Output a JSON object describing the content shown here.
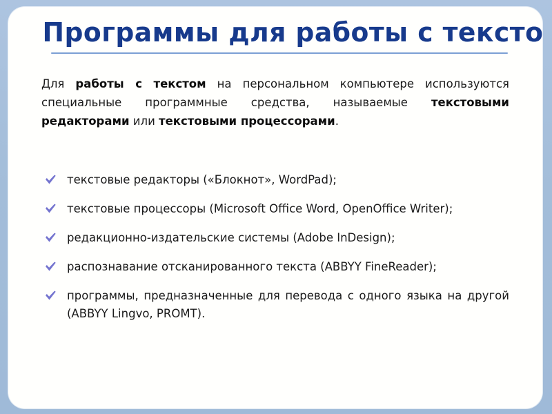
{
  "slide": {
    "title": "Программы для работы с текстом",
    "accent_title_color": "#173a8c",
    "rule_color": "#7b9fd4",
    "frame_color": "#a3bdd9",
    "card_color": "#fffffd",
    "bullet_color": "#7474cf",
    "body_color": "#1b1b1b"
  },
  "intro": {
    "part1": "Для ",
    "bold1": "работы с текстом",
    "part2": " на персональном компьютере используются специальные программные средства, называемые ",
    "bold2": "текстовыми редакторами",
    "part3": " или ",
    "bold3": "текстовыми процессорами",
    "part4": "."
  },
  "list": {
    "bullet_icon": "check-icon",
    "items": [
      {
        "text": "текстовые редакторы («Блокнот», WordPad);"
      },
      {
        "text": "текстовые процессоры (Microsoft Office Word, OpenOffice Writer);"
      },
      {
        "text": "редакционно-издательские системы (Adobe InDesign);"
      },
      {
        "text": "распознавание отсканированного текста (ABBYY FineReader);"
      },
      {
        "text": "программы, предназначенные для перевода с одного языка на другой (ABBYY Lingvo, PROMT)."
      }
    ]
  }
}
